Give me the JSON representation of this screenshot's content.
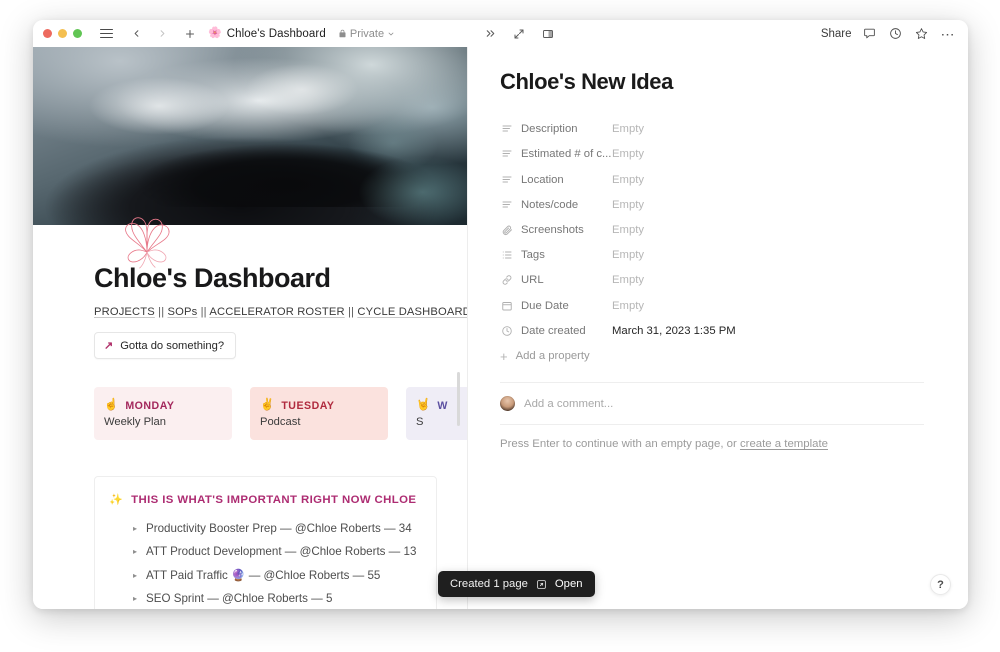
{
  "window": {
    "traffic_lights": [
      "close",
      "minimize",
      "maximize"
    ],
    "left_titlebar": {
      "menu_icon": "hamburger-icon",
      "back_icon": "chevron-left-icon",
      "forward_icon": "chevron-right-icon",
      "new_icon": "plus-icon",
      "page_emoji": "🌸",
      "page_title": "Chloe's Dashboard",
      "privacy_label": "Private",
      "lock_icon": "lock-icon",
      "chevron_icon": "chevron-down-icon"
    },
    "right_titlebar": {
      "expand_icon": "double-chevron-right-icon",
      "fullscreen_icon": "diagonal-arrows-icon",
      "sidepeek_icon": "side-peek-icon",
      "share_label": "Share",
      "comment_icon": "comment-icon",
      "history_icon": "clock-icon",
      "favorite_icon": "star-icon",
      "more_icon": "ellipsis-icon"
    }
  },
  "dashboard": {
    "cover_alt": "abstract dark teal and grey painted cover",
    "page_icon": "pink-flower-icon",
    "title": "Chloe's Dashboard",
    "nav_links": [
      {
        "label": "PROJECTS"
      },
      {
        "label": "SOPs"
      },
      {
        "label": "ACCELERATOR ROSTER"
      },
      {
        "label": "CYCLE DASHBOARD"
      }
    ],
    "nav_separator": "||",
    "cta": {
      "icon": "arrow-up-right-icon",
      "label": "Gotta do something?"
    },
    "day_cards": [
      {
        "emoji": "☝️",
        "day": "MONDAY",
        "subtitle": "Weekly Plan"
      },
      {
        "emoji": "✌️",
        "day": "TUESDAY",
        "subtitle": "Podcast"
      },
      {
        "emoji": "🤘",
        "day": "W",
        "subtitle": "S"
      }
    ],
    "important_panel": {
      "emoji": "✨",
      "title": "THIS IS WHAT'S IMPORTANT RIGHT NOW CHLOE",
      "items": [
        {
          "toggle": "▸",
          "text": "Productivity Booster Prep — @Chloe Roberts — 34"
        },
        {
          "toggle": "▸",
          "text": "ATT Product Development — @Chloe Roberts  — 13"
        },
        {
          "toggle": "▸",
          "text": "ATT Paid Traffic 🔮 — @Chloe Roberts  — 55"
        },
        {
          "toggle": "▸",
          "text": "SEO Sprint — @Chloe Roberts — 5"
        }
      ]
    }
  },
  "peek": {
    "title": "Chloe's New Idea",
    "properties": [
      {
        "icon": "text-lines-icon",
        "label": "Description",
        "value": "Empty",
        "filled": false
      },
      {
        "icon": "text-lines-icon",
        "label": "Estimated # of c...",
        "value": "Empty",
        "filled": false
      },
      {
        "icon": "text-lines-icon",
        "label": "Location",
        "value": "Empty",
        "filled": false
      },
      {
        "icon": "text-lines-icon",
        "label": "Notes/code",
        "value": "Empty",
        "filled": false
      },
      {
        "icon": "paperclip-icon",
        "label": "Screenshots",
        "value": "Empty",
        "filled": false
      },
      {
        "icon": "list-icon",
        "label": "Tags",
        "value": "Empty",
        "filled": false
      },
      {
        "icon": "link-icon",
        "label": "URL",
        "value": "Empty",
        "filled": false
      },
      {
        "icon": "calendar-icon",
        "label": "Due Date",
        "value": "Empty",
        "filled": false
      },
      {
        "icon": "clock-icon",
        "label": "Date created",
        "value": "March 31, 2023 1:35 PM",
        "filled": true
      }
    ],
    "add_property_label": "Add a property",
    "comment_placeholder": "Add a comment...",
    "empty_hint_prefix": "Press Enter to continue with an empty page, or ",
    "empty_hint_link": "create a template",
    "help_label": "?"
  },
  "toast": {
    "message": "Created 1 page",
    "action_icon": "open-box-icon",
    "action_label": "Open"
  },
  "colors": {
    "accent_pink": "#ad2c72",
    "monday_bg": "#fbeff0",
    "tuesday_bg": "#fbe2de",
    "wednesday_bg": "#efedf6",
    "toast_bg": "#1f1f1f"
  }
}
